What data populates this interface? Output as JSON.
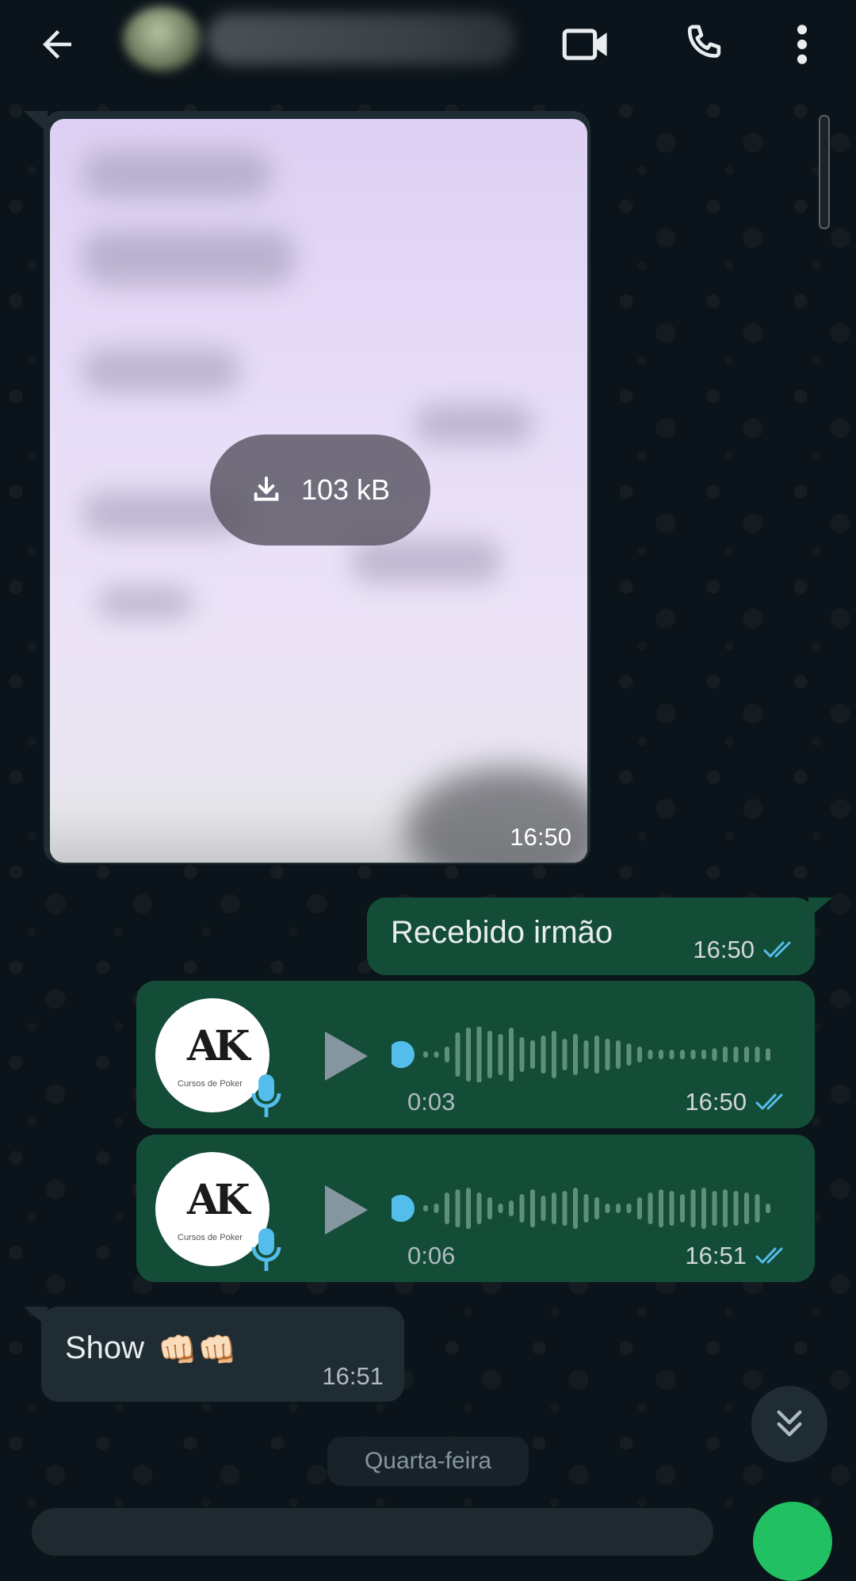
{
  "header": {
    "contact_name": "",
    "icons": [
      "arrow-back-icon",
      "video-call-icon",
      "voice-call-icon",
      "more-vert-icon"
    ]
  },
  "messages": [
    {
      "type": "image",
      "direction": "incoming",
      "download_size": "103 kB",
      "time": "16:50"
    },
    {
      "type": "text",
      "direction": "outgoing",
      "text": "Recebido irmão",
      "time": "16:50",
      "status": "read"
    },
    {
      "type": "voice",
      "direction": "outgoing",
      "duration": "0:03",
      "time": "16:50",
      "status": "read",
      "avatar_logo": "AK",
      "avatar_caption": "Cursos de Poker",
      "progress": 0
    },
    {
      "type": "voice",
      "direction": "outgoing",
      "duration": "0:06",
      "time": "16:51",
      "status": "read",
      "avatar_logo": "AK",
      "avatar_caption": "Cursos de Poker",
      "progress": 0
    },
    {
      "type": "text",
      "direction": "incoming",
      "text": "Show",
      "emoji": "👊🏻👊🏻",
      "time": "16:51"
    }
  ],
  "date_separator": "Quarta-feira",
  "colors": {
    "background": "#0b141a",
    "incoming_bubble": "#202c33",
    "outgoing_bubble": "#144d37",
    "read_ticks": "#53bdeb",
    "accent_green": "#21c063"
  }
}
